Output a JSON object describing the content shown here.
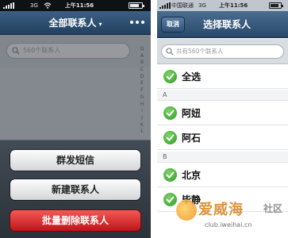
{
  "left_phone": {
    "status_bar": {
      "network": "3G",
      "time": "上午11:56"
    },
    "nav": {
      "title": "全部联系人",
      "caret": "▾"
    },
    "search": {
      "placeholder": "560个联系人"
    },
    "index_letters": [
      "Q",
      "A",
      "B",
      "C",
      "D",
      "E",
      "F",
      "G",
      "H",
      "I",
      "J",
      "K",
      "L"
    ],
    "action_sheet": {
      "send_label": "群发短信",
      "new_label": "新建联系人",
      "delete_label": "批量删除联系人"
    }
  },
  "right_phone": {
    "status_bar": {
      "carrier": "中国联通",
      "network": "3G",
      "time": "上午11:56"
    },
    "nav": {
      "cancel_label": "取消",
      "title": "选择联系人"
    },
    "search": {
      "placeholder": "共有560个联系人"
    },
    "select_all_label": "全选",
    "sections": [
      {
        "letter": "A",
        "contacts": [
          "阿妞",
          "阿石"
        ]
      },
      {
        "letter": "B",
        "contacts": [
          "北京",
          "毕静"
        ]
      }
    ]
  },
  "watermark": {
    "text": "爱威海",
    "badge": "社区",
    "url": "club.iweihai.cn"
  },
  "colors": {
    "accent_blue": "#27486a",
    "danger_red": "#c0141a",
    "check_green": "#2e9a22"
  }
}
